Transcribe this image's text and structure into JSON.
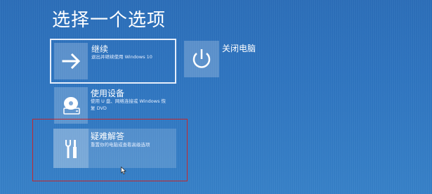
{
  "page": {
    "title": "选择一个选项"
  },
  "options": {
    "continue": {
      "label": "继续",
      "description": "退出并继续使用 Windows 10",
      "icon": "arrow-right-icon"
    },
    "shutdown": {
      "label": "关闭电脑",
      "icon": "power-icon"
    },
    "use_device": {
      "label": "使用设备",
      "description_line1": "使用 U 盘、网络连接或 Windows 恢",
      "description_line2": "复 DVD",
      "icon": "disc-drive-icon"
    },
    "troubleshoot": {
      "label": "疑难解答",
      "description": "重置你的电脑或查看高级选项",
      "icon": "tools-icon"
    }
  },
  "colors": {
    "background": "#2d74c0",
    "highlight": "#c0272d"
  }
}
